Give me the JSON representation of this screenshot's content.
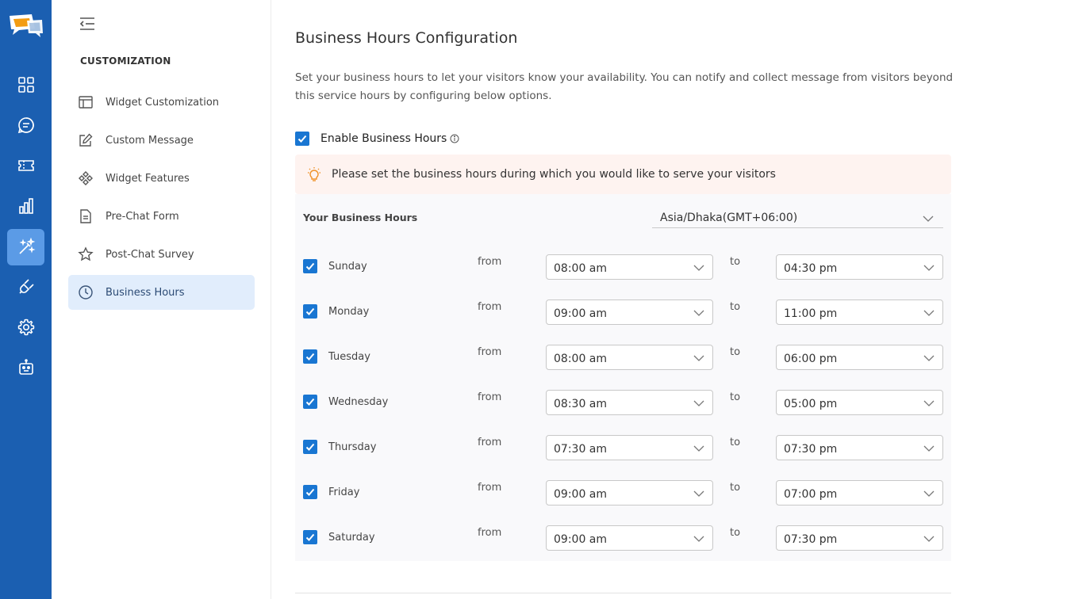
{
  "sidebar": {
    "section_title": "CUSTOMIZATION",
    "items": [
      {
        "label": "Widget Customization"
      },
      {
        "label": "Custom Message"
      },
      {
        "label": "Widget Features"
      },
      {
        "label": "Pre-Chat Form"
      },
      {
        "label": "Post-Chat Survey"
      },
      {
        "label": "Business Hours",
        "active": true
      }
    ]
  },
  "main": {
    "title": "Business Hours Configuration",
    "description": "Set your business hours to let your visitors know your availability. You can notify and collect message from visitors beyond this service hours by configuring below options.",
    "enable_label": "Enable Business Hours",
    "enable_checked": true,
    "alert_text": "Please set the business hours during which you would like to serve your visitors",
    "hours_label": "Your Business Hours",
    "timezone": "Asia/Dhaka(GMT+06:00)",
    "from_label": "from",
    "to_label": "to",
    "days": [
      {
        "name": "Sunday",
        "checked": true,
        "from": "08:00 am",
        "to": "04:30 pm"
      },
      {
        "name": "Monday",
        "checked": true,
        "from": "09:00 am",
        "to": "11:00 pm"
      },
      {
        "name": "Tuesday",
        "checked": true,
        "from": "08:00 am",
        "to": "06:00 pm"
      },
      {
        "name": "Wednesday",
        "checked": true,
        "from": "08:30 am",
        "to": "05:00 pm"
      },
      {
        "name": "Thursday",
        "checked": true,
        "from": "07:30 am",
        "to": "07:30 pm"
      },
      {
        "name": "Friday",
        "checked": true,
        "from": "09:00 am",
        "to": "07:00 pm"
      },
      {
        "name": "Saturday",
        "checked": true,
        "from": "09:00 am",
        "to": "07:30 pm"
      }
    ]
  },
  "colors": {
    "rail": "#1b5fb1",
    "rail_active": "#5b9be6",
    "checkbox": "#1976d2",
    "sidebar_active": "#e1edfc",
    "alert_bg": "#fef3f0",
    "alert_icon": "#f0932b",
    "logo_orange": "#f39c12"
  },
  "icons": {
    "rail": [
      "dashboard-icon",
      "chat-icon",
      "ticket-icon",
      "analytics-icon",
      "magic-wand-icon",
      "plug-icon",
      "settings-icon",
      "bot-icon"
    ]
  }
}
